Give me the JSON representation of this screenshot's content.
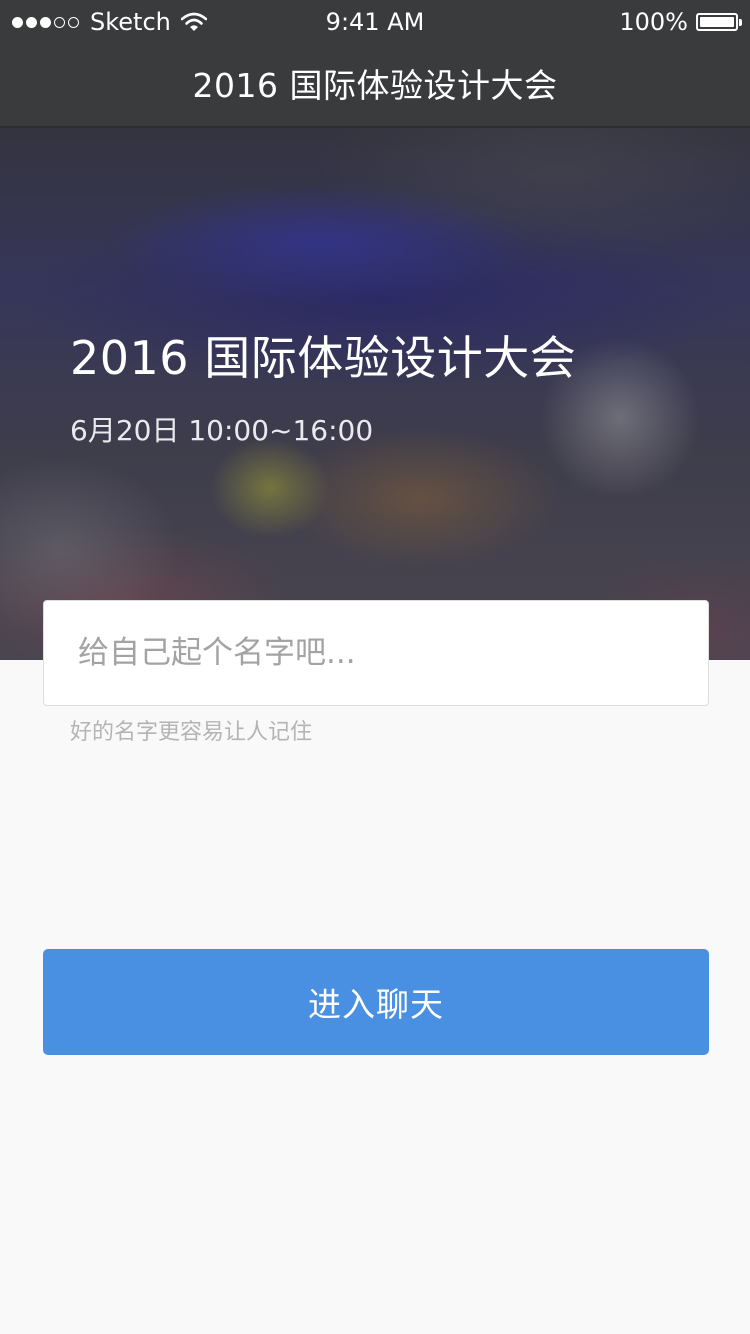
{
  "status_bar": {
    "signal_filled": 3,
    "signal_total": 5,
    "carrier": "Sketch",
    "time": "9:41 AM",
    "battery_percent": "100%",
    "battery_level": 1.0,
    "wifi_icon": "wifi-icon",
    "battery_icon": "battery-icon"
  },
  "nav": {
    "title": "2016 国际体验设计大会"
  },
  "hero": {
    "title": "2016 国际体验设计大会",
    "date": "6月20日 10:00~16:00"
  },
  "form": {
    "name_placeholder": "给自己起个名字吧...",
    "name_value": "",
    "hint": "好的名字更容易让人记住",
    "enter_label": "进入聊天"
  },
  "colors": {
    "nav_background": "#3a3b3d",
    "page_background": "#f9f9f9",
    "primary_button": "#4a90e2",
    "hint_text": "#b4b4b4",
    "placeholder_text": "#a3a3a3"
  }
}
